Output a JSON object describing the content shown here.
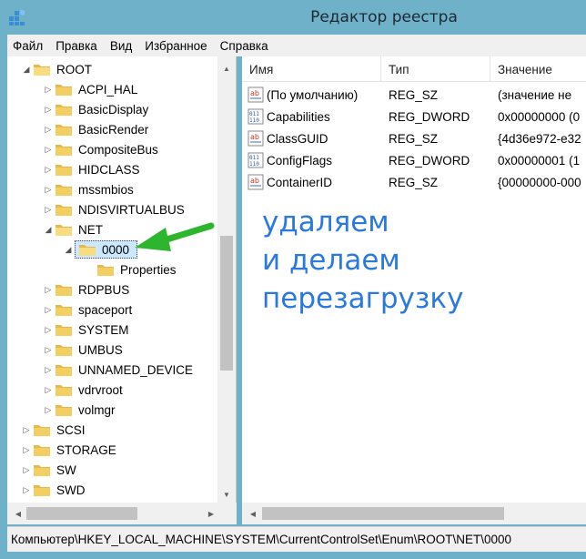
{
  "window": {
    "title": "Редактор реестра"
  },
  "menu": [
    "Файл",
    "Правка",
    "Вид",
    "Избранное",
    "Справка"
  ],
  "tree": [
    {
      "label": "ROOT",
      "expander": "open",
      "level": 0
    },
    {
      "label": "ACPI_HAL",
      "expander": "closed",
      "level": 1
    },
    {
      "label": "BasicDisplay",
      "expander": "closed",
      "level": 1
    },
    {
      "label": "BasicRender",
      "expander": "closed",
      "level": 1
    },
    {
      "label": "CompositeBus",
      "expander": "closed",
      "level": 1
    },
    {
      "label": "HIDCLASS",
      "expander": "closed",
      "level": 1
    },
    {
      "label": "mssmbios",
      "expander": "closed",
      "level": 1
    },
    {
      "label": "NDISVIRTUALBUS",
      "expander": "closed",
      "level": 1
    },
    {
      "label": "NET",
      "expander": "open",
      "level": 1
    },
    {
      "label": "0000",
      "expander": "open",
      "level": 2,
      "selected": true
    },
    {
      "label": "Properties",
      "expander": "none",
      "level": 3
    },
    {
      "label": "RDPBUS",
      "expander": "closed",
      "level": 1
    },
    {
      "label": "spaceport",
      "expander": "closed",
      "level": 1
    },
    {
      "label": "SYSTEM",
      "expander": "closed",
      "level": 1
    },
    {
      "label": "UMBUS",
      "expander": "closed",
      "level": 1
    },
    {
      "label": "UNNAMED_DEVICE",
      "expander": "closed",
      "level": 1
    },
    {
      "label": "vdrvroot",
      "expander": "closed",
      "level": 1
    },
    {
      "label": "volmgr",
      "expander": "closed",
      "level": 1
    },
    {
      "label": "SCSI",
      "expander": "closed",
      "level": 0
    },
    {
      "label": "STORAGE",
      "expander": "closed",
      "level": 0
    },
    {
      "label": "SW",
      "expander": "closed",
      "level": 0
    },
    {
      "label": "SWD",
      "expander": "closed",
      "level": 0
    }
  ],
  "columns": {
    "name": "Имя",
    "type": "Тип",
    "value": "Значение"
  },
  "values": [
    {
      "icon": "string-value-icon",
      "name": "(По умолчанию)",
      "type": "REG_SZ",
      "data": "(значение не"
    },
    {
      "icon": "dword-value-icon",
      "name": "Capabilities",
      "type": "REG_DWORD",
      "data": "0x00000000 (0"
    },
    {
      "icon": "string-value-icon",
      "name": "ClassGUID",
      "type": "REG_SZ",
      "data": "{4d36e972-e32"
    },
    {
      "icon": "dword-value-icon",
      "name": "ConfigFlags",
      "type": "REG_DWORD",
      "data": "0x00000001 (1"
    },
    {
      "icon": "string-value-icon",
      "name": "ContainerID",
      "type": "REG_SZ",
      "data": "{00000000-000"
    }
  ],
  "annotation": [
    "удаляем",
    "и делаем",
    "перезагрузку"
  ],
  "status": "Компьютер\\HKEY_LOCAL_MACHINE\\SYSTEM\\CurrentControlSet\\Enum\\ROOT\\NET\\0000",
  "colors": {
    "titlebar": "#6fb1c9",
    "annotation_text": "#2a78e2",
    "arrow": "#2db52d",
    "selection": "#cce8ff"
  }
}
